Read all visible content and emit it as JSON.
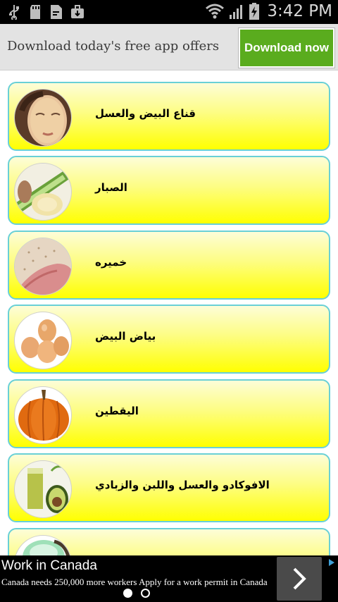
{
  "status_bar": {
    "time": "3:42 PM",
    "icons_left": [
      "usb-icon",
      "sd-card-icon",
      "file-icon",
      "briefcase-icon"
    ],
    "icons_right": [
      "wifi-icon",
      "signal-icon",
      "battery-charging-icon"
    ]
  },
  "top_ad": {
    "text": "Download today's free app offers",
    "button_label": "Download now",
    "button_color": "#5aac1e"
  },
  "list": {
    "card_border_color": "#69d0d6",
    "card_fill_color": "#ffff00",
    "items": [
      {
        "label": "قناع البيض والعسل",
        "thumb": "face-mask-photo"
      },
      {
        "label": "الصبار",
        "thumb": "aloe-vera-photo"
      },
      {
        "label": "خميره",
        "thumb": "yeast-photo"
      },
      {
        "label": "بياض البيض",
        "thumb": "eggs-photo"
      },
      {
        "label": "اليقطين",
        "thumb": "pumpkin-photo"
      },
      {
        "label": "الافوكادو والعسل واللبن والزبادي",
        "thumb": "avocado-juice-photo"
      },
      {
        "label": "",
        "thumb": "partial-item-photo"
      }
    ]
  },
  "bottom_ad": {
    "title": "Work in Canada",
    "description": "Canada needs 250,000 more workers Apply for a work permit in Canada",
    "pager": {
      "total": 2,
      "active": 1
    }
  }
}
